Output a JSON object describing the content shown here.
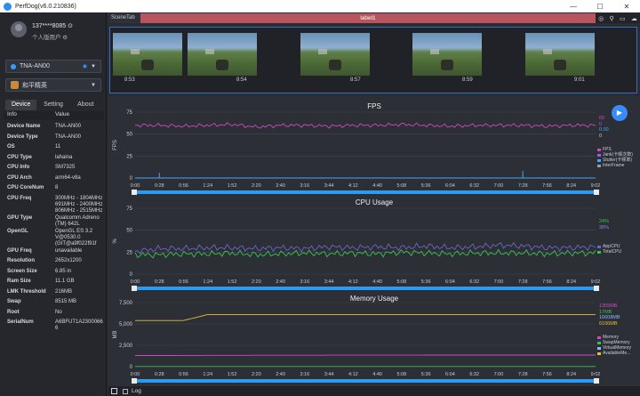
{
  "window": {
    "title": "PerfDog(v6.0.210836)",
    "minimize": "—",
    "maximize": "☐",
    "close": "✕"
  },
  "user": {
    "name": "137****8085 ⊙",
    "role": "个人版用户 ⚙"
  },
  "device_select": {
    "label": "TNA-AN00"
  },
  "app_select": {
    "label": "和平精英"
  },
  "tabs": [
    "Device",
    "Setting",
    "About"
  ],
  "info_header": {
    "key": "Info",
    "value": "Value"
  },
  "device_info": [
    {
      "key": "Device Name",
      "value": "TNA-AN00"
    },
    {
      "key": "Device Type",
      "value": "TNA-AN00"
    },
    {
      "key": "OS",
      "value": "11"
    },
    {
      "key": "CPU Type",
      "value": "lahaina"
    },
    {
      "key": "CPU Info",
      "value": "SM7325"
    },
    {
      "key": "CPU Arch",
      "value": "arm64-v8a"
    },
    {
      "key": "CPU CoreNum",
      "value": "8"
    },
    {
      "key": "CPU Freq",
      "value": "300MHz - 1804MHz\n691MHz - 2400MHz\n806MHz - 2515MHz"
    },
    {
      "key": "GPU Type",
      "value": "Qualcomm Adreno\n(TM) 642L"
    },
    {
      "key": "OpenGL",
      "value": "OpenGL ES 3.2\nV@0530.0\n(GIT@a9f022f91f"
    },
    {
      "key": "GPU Freq",
      "value": "unavailable"
    },
    {
      "key": "Resolution",
      "value": "2652x1200"
    },
    {
      "key": "Screen Size",
      "value": "6.85 in"
    },
    {
      "key": "Ram Size",
      "value": "11.1 GB"
    },
    {
      "key": "LMK Threshold",
      "value": "216MB"
    },
    {
      "key": "Swap",
      "value": "8515 MB"
    },
    {
      "key": "Root",
      "value": "No"
    },
    {
      "key": "SerialNum",
      "value": "A6BFUT1A2300066\n6"
    }
  ],
  "scene": {
    "tab": "SceneTab",
    "label": "label1",
    "icons": [
      "location-icon",
      "pin-icon",
      "folder-icon",
      "cloud-icon"
    ]
  },
  "screenshots": [
    "8:53",
    "8:54",
    "8:57",
    "8:59",
    "9:01"
  ],
  "time_axis": [
    "0:00",
    "0:28",
    "0:56",
    "1:24",
    "1:52",
    "2:20",
    "2:40",
    "3:16",
    "3:44",
    "4:12",
    "4:40",
    "5:08",
    "5:36",
    "6:04",
    "6:32",
    "7:00",
    "7:28",
    "7:56",
    "8:24",
    "9:02"
  ],
  "colors": {
    "fps": "#d147c4",
    "jank": "#8a2be2",
    "stutter": "#3fa8ff",
    "app_cpu": "#6e63c9",
    "total_cpu": "#38c24a",
    "memory": "#d147c4",
    "swap": "#38c24a",
    "virtual": "#8ab4ff",
    "available": "#e6c03a",
    "scroll": "#2b9af3"
  },
  "fps_chart": {
    "title": "FPS",
    "ylabel": "FPS",
    "yticks": [
      "75",
      "50",
      "25",
      "0"
    ],
    "readings": [
      "60",
      "0",
      "0.00",
      "0"
    ],
    "legend": [
      "FPS",
      "Jank(卡顿次数)",
      "Stutter(卡顿率)",
      "InterFrame"
    ]
  },
  "cpu_chart": {
    "title": "CPU Usage",
    "ylabel": "%",
    "yticks": [
      "75",
      "50",
      "25",
      "0"
    ],
    "readings": [
      "24%",
      "38%"
    ],
    "legend": [
      "AppCPU",
      "TotalCPU"
    ]
  },
  "mem_chart": {
    "title": "Memory Usage",
    "ylabel": "MB",
    "yticks": [
      "7,500",
      "5,000",
      "2,500",
      "0"
    ],
    "readings": [
      "1355MB",
      "17MB",
      "16608MB",
      "6106MB"
    ],
    "legend": [
      "Memory",
      "SwapMemory",
      "VirtualMemory",
      "AvailableMe..."
    ]
  },
  "chart_data": [
    {
      "type": "line",
      "title": "FPS",
      "ylabel": "FPS",
      "ylim": [
        0,
        75
      ],
      "series": [
        {
          "name": "FPS",
          "values": [
            60,
            60,
            59,
            60,
            61,
            58,
            60,
            60,
            59,
            60,
            60,
            61,
            60,
            59,
            60,
            60,
            60,
            59,
            60,
            60
          ]
        },
        {
          "name": "InterFrame",
          "values": [
            0,
            6,
            0,
            0,
            0,
            0,
            0,
            0,
            0,
            0,
            0,
            0,
            0,
            0,
            0,
            0,
            8,
            0,
            0,
            0
          ]
        }
      ]
    },
    {
      "type": "line",
      "title": "CPU Usage",
      "ylabel": "%",
      "ylim": [
        0,
        75
      ],
      "series": [
        {
          "name": "AppCPU",
          "values": [
            26,
            29,
            29,
            30,
            30,
            29,
            30,
            29,
            31,
            30,
            31,
            30,
            32,
            30,
            31,
            33,
            32,
            30,
            30,
            31
          ]
        },
        {
          "name": "TotalCPU",
          "values": [
            22,
            22,
            23,
            23,
            24,
            22,
            23,
            24,
            23,
            24,
            23,
            25,
            24,
            23,
            24,
            24,
            24,
            23,
            24,
            24
          ]
        }
      ]
    },
    {
      "type": "line",
      "title": "Memory Usage",
      "ylabel": "MB",
      "ylim": [
        0,
        7500
      ],
      "series": [
        {
          "name": "Memory",
          "values": [
            1300,
            1300,
            1310,
            1320,
            1320,
            1330,
            1330,
            1330,
            1340,
            1340,
            1340,
            1340,
            1350,
            1350,
            1350,
            1350,
            1355,
            1355,
            1355,
            1355
          ]
        },
        {
          "name": "SwapMemory",
          "values": [
            17,
            17,
            17,
            17,
            17,
            17,
            17,
            17,
            17,
            17,
            17,
            17,
            17,
            17,
            17,
            17,
            17,
            17,
            17,
            17
          ]
        },
        {
          "name": "AvailableMemory",
          "values": [
            5400,
            5400,
            5400,
            6100,
            6100,
            6100,
            6100,
            6100,
            6100,
            6100,
            6100,
            6100,
            6100,
            6100,
            6100,
            6100,
            6100,
            6100,
            6100,
            6106
          ]
        }
      ]
    }
  ],
  "status": {
    "log": "Log"
  }
}
